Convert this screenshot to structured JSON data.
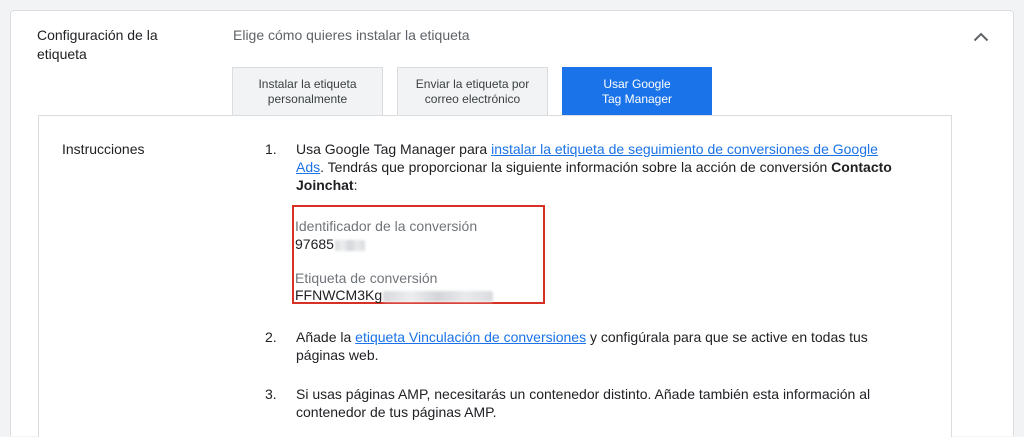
{
  "section": {
    "title": "Configuración de la etiqueta",
    "subtitle": "Elige cómo quieres instalar la etiqueta"
  },
  "tabs": [
    {
      "label": "Instalar la etiqueta personalmente",
      "selected": false
    },
    {
      "label": "Enviar la etiqueta por correo electrónico",
      "selected": false
    },
    {
      "label": "Usar Google Tag Manager",
      "selected": true
    }
  ],
  "panel": {
    "label": "Instrucciones",
    "steps": [
      {
        "number": "1.",
        "text_before": "Usa Google Tag Manager para ",
        "link": "instalar la etiqueta de seguimiento de conversiones de Google Ads",
        "text_after": ". Tendrás que proporcionar la siguiente información sobre la acción de conversión ",
        "bold": "Contacto Joinchat",
        "end": ":"
      },
      {
        "number": "2.",
        "text_before": "Añade la ",
        "link": "etiqueta Vinculación de conversiones",
        "text_after": " y configúrala para que se active en todas tus páginas web."
      },
      {
        "number": "3.",
        "text": "Si usas páginas AMP, necesitarás un contenedor distinto. Añade también esta información al contenedor de tus páginas AMP."
      }
    ],
    "conversion_id_label": "Identificador de la conversión",
    "conversion_id_value": "97685",
    "conversion_label_label": "Etiqueta de conversión",
    "conversion_label_value": "FFNWCM3Kg"
  },
  "colors": {
    "accent": "#1a73e8",
    "highlight_border": "#d93025"
  },
  "icons": {
    "collapse": "chevron-up-icon"
  }
}
